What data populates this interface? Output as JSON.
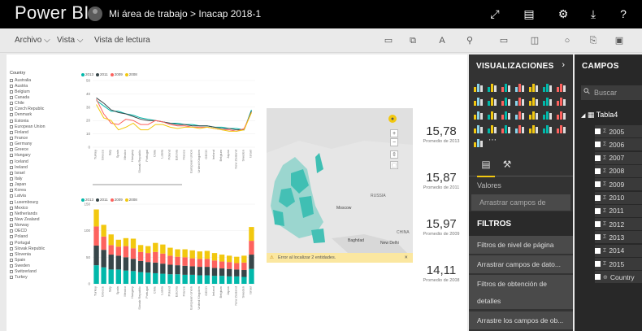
{
  "titlebar": {
    "app_name": "Power BI",
    "breadcrumb": "Mi área de trabajo > Inacap 2018-1"
  },
  "menu": {
    "archivo": "Archivo ",
    "vista": "Vista ",
    "reading_view": "Vista de lectura"
  },
  "slicer": {
    "title": "Country",
    "items": [
      "Australia",
      "Austria",
      "Belgium",
      "Canada",
      "Chile",
      "Czech Republic",
      "Denmark",
      "Estonia",
      "European Union",
      "Finland",
      "France",
      "Germany",
      "Greece",
      "Hungary",
      "Iceland",
      "Ireland",
      "Israel",
      "Italy",
      "Japan",
      "Korea",
      "Latvia",
      "Luxembourg",
      "Mexico",
      "Netherlands",
      "New Zealand",
      "Norway",
      "OECD",
      "Poland",
      "Portugal",
      "Slovak Republic",
      "Slovenia",
      "Spain",
      "Sweden",
      "Switzerland",
      "Turkey"
    ]
  },
  "chart_data": [
    {
      "type": "line",
      "legend": [
        "2013",
        "2011",
        "2009",
        "2008"
      ],
      "colors": [
        "#01b8aa",
        "#374649",
        "#fd625e",
        "#f2c80f"
      ],
      "categories": [
        "Turkey",
        "Greece",
        "Italy",
        "Spain",
        "Mexico",
        "Hungary",
        "Slovak Republic",
        "Portugal",
        "Chile",
        "Latvia",
        "Poland",
        "Estonia",
        "France",
        "European Union",
        "United Kingdom",
        "OECD",
        "Ireland",
        "Belgium",
        "Japan",
        "New Zealand",
        "Sweden",
        "Israel"
      ],
      "ylim": [
        0,
        50
      ],
      "yticks": [
        0,
        10,
        20,
        30,
        40,
        50
      ],
      "series": [
        {
          "name": "2013",
          "values": [
            35,
            31,
            27,
            27,
            25,
            24,
            22,
            21,
            20,
            19,
            18,
            18,
            17,
            17,
            16,
            16,
            15,
            15,
            14,
            14,
            13,
            28
          ]
        },
        {
          "name": "2011",
          "values": [
            37,
            33,
            28,
            26,
            25,
            23,
            21,
            20,
            20,
            19,
            18,
            17,
            17,
            16,
            16,
            16,
            15,
            14,
            14,
            13,
            13,
            27
          ]
        },
        {
          "name": "2009",
          "values": [
            36,
            25,
            18,
            17,
            21,
            20,
            17,
            17,
            20,
            19,
            17,
            16,
            16,
            15,
            15,
            15,
            14,
            13,
            13,
            12,
            14,
            26
          ]
        },
        {
          "name": "2008",
          "values": [
            32,
            22,
            20,
            13,
            15,
            18,
            13,
            13,
            17,
            17,
            15,
            14,
            15,
            15,
            14,
            15,
            14,
            13,
            12,
            12,
            13,
            26
          ]
        }
      ]
    },
    {
      "type": "bar",
      "stacked": true,
      "legend": [
        "2013",
        "2011",
        "2009",
        "2008"
      ],
      "colors": [
        "#01b8aa",
        "#374649",
        "#fd625e",
        "#f2c80f"
      ],
      "categories": [
        "Turkey",
        "Greece",
        "Italy",
        "Spain",
        "Mexico",
        "Hungary",
        "Slovak Republic",
        "Portugal",
        "Chile",
        "Latvia",
        "Poland",
        "Estonia",
        "France",
        "European Union",
        "United Kingdom",
        "OECD",
        "Ireland",
        "Belgium",
        "Japan",
        "New Zealand",
        "Sweden",
        "Israel"
      ],
      "ylim": [
        0,
        150
      ],
      "yticks": [
        0,
        50,
        100,
        150
      ],
      "series": [
        {
          "name": "2013",
          "values": [
            35,
            31,
            27,
            27,
            25,
            24,
            22,
            21,
            20,
            19,
            18,
            18,
            17,
            17,
            16,
            16,
            15,
            15,
            14,
            14,
            13,
            28
          ]
        },
        {
          "name": "2011",
          "values": [
            37,
            33,
            28,
            26,
            25,
            23,
            21,
            20,
            20,
            19,
            18,
            17,
            17,
            16,
            16,
            16,
            15,
            14,
            14,
            13,
            13,
            27
          ]
        },
        {
          "name": "2009",
          "values": [
            36,
            25,
            18,
            17,
            21,
            20,
            17,
            17,
            20,
            19,
            17,
            16,
            16,
            15,
            15,
            15,
            14,
            13,
            13,
            12,
            14,
            26
          ]
        },
        {
          "name": "2008",
          "values": [
            32,
            22,
            20,
            13,
            15,
            18,
            13,
            13,
            17,
            17,
            15,
            14,
            15,
            15,
            14,
            15,
            14,
            13,
            12,
            12,
            13,
            26
          ]
        }
      ]
    }
  ],
  "map": {
    "labels": [
      "RUSSIA",
      "Moscow",
      "Baghdad",
      "New Delhi",
      "CHINA"
    ],
    "error": "Error al localizar 2 entidades."
  },
  "cards": [
    {
      "value": "15,78",
      "label": "Promedio de 2013"
    },
    {
      "value": "15,87",
      "label": "Promedio de 2011"
    },
    {
      "value": "15,97",
      "label": "Promedio de 2009"
    },
    {
      "value": "14,11",
      "label": "Promedio de 2008"
    }
  ],
  "visualizations": {
    "title": "VISUALIZACIONES",
    "values_label": "Valores",
    "drag_fields": "Arrastrar campos de datos...",
    "filters_title": "FILTROS",
    "filters": [
      "Filtros de nivel de página",
      "Arrastrar campos de dato...",
      "Filtros de obtención de",
      "detalles",
      "Arrastre los campos de ob..."
    ]
  },
  "fields": {
    "title": "CAMPOS",
    "search_placeholder": "Buscar",
    "table": "Tabla4",
    "items": [
      "2005",
      "2006",
      "2007",
      "2008",
      "2009",
      "2010",
      "2011",
      "2012",
      "2013",
      "2014",
      "2015",
      "Country"
    ]
  }
}
